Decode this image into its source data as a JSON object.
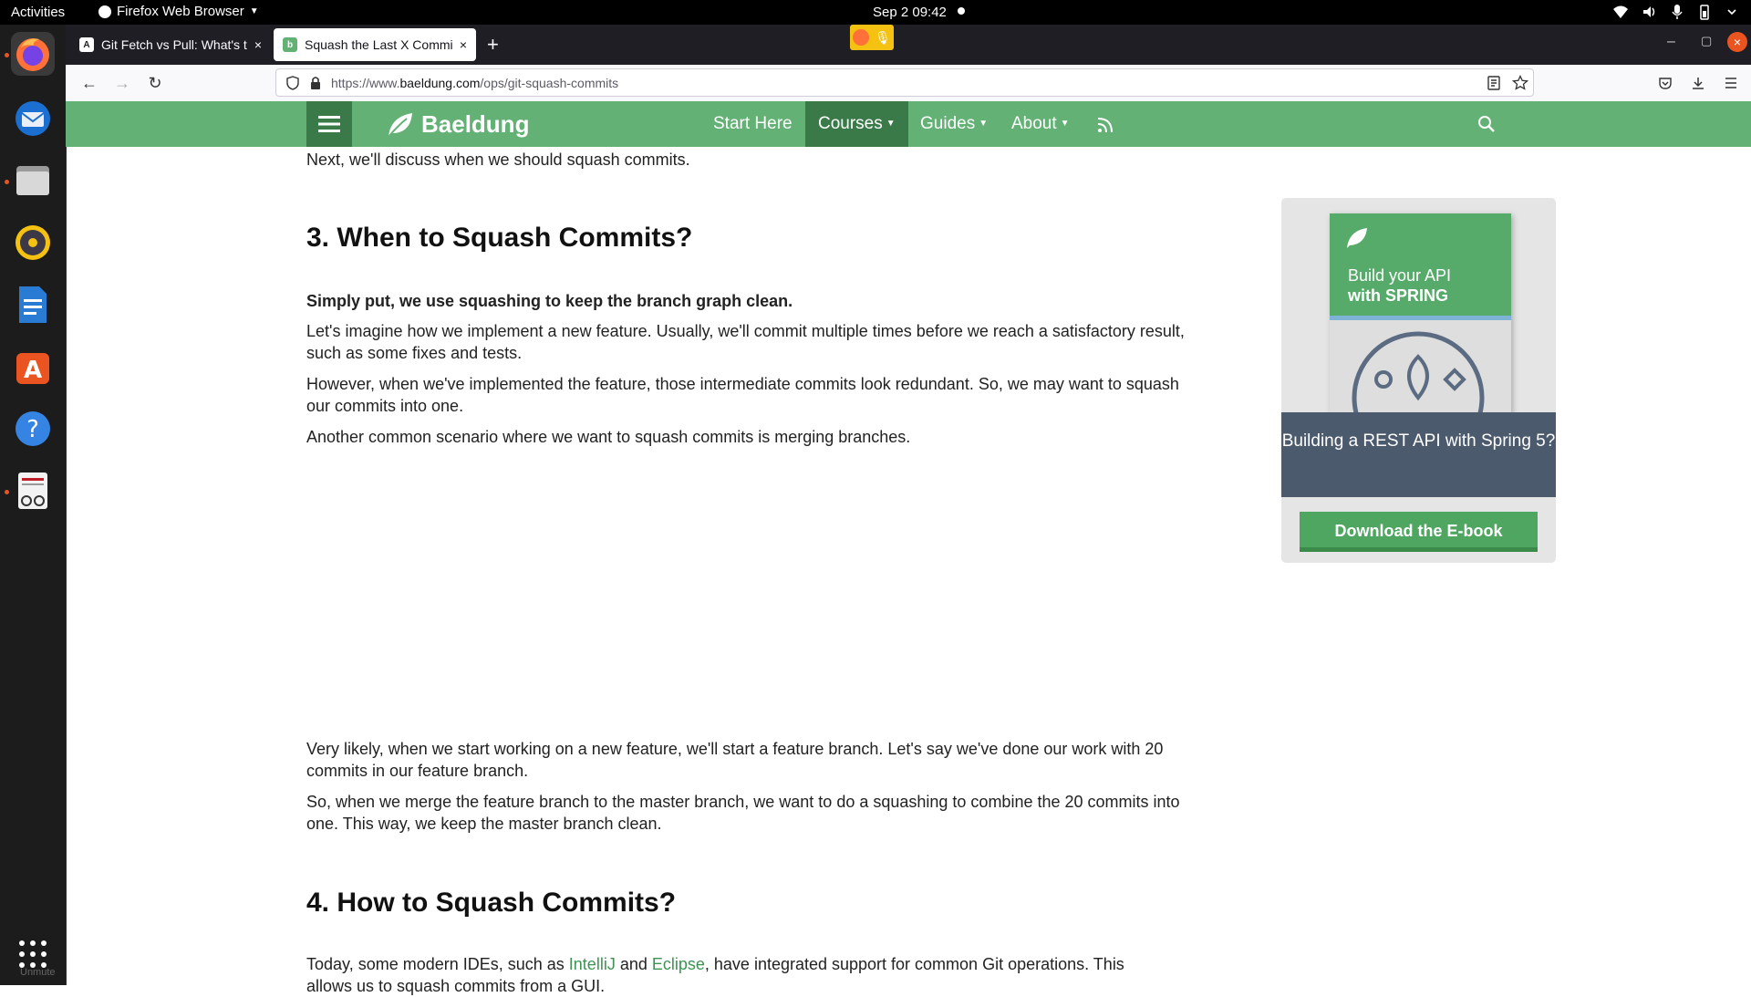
{
  "system": {
    "activities": "Activities",
    "app_menu": "Firefox Web Browser",
    "datetime": "Sep 2  09:42"
  },
  "dock": {
    "items": [
      "firefox-icon",
      "thunderbird-icon",
      "files-icon",
      "rhythmbox-icon",
      "writer-icon",
      "software-icon",
      "help-icon",
      "reader-icon"
    ],
    "show_apps_label": "Unmute"
  },
  "browser": {
    "tabs": [
      {
        "title": "Git Fetch vs Pull: What's t",
        "active": false
      },
      {
        "title": "Squash the Last X Commi",
        "active": true
      }
    ],
    "new_tab": "+",
    "url": {
      "prefix": "https://www.",
      "domain": "baeldung.com",
      "path": "/ops/git-squash-commits"
    }
  },
  "site": {
    "brand": "Baeldung",
    "menu": [
      "Start Here",
      "Courses",
      "Guides",
      "About"
    ],
    "accent": "#63b175"
  },
  "article": {
    "intro": "Next, we'll discuss when we should squash commits.",
    "section3": {
      "heading": "3. When to Squash Commits?",
      "lead": "Simply put, we use squashing to keep the branch graph clean.",
      "p1": "Let's imagine how we implement a new feature. Usually, we'll commit multiple times before we reach a satisfactory result, such as some fixes and tests.",
      "p2": "However, when we've implemented the feature, those intermediate commits look redundant. So, we may want to squash our commits into one.",
      "p3": "Another common scenario where we want to squash commits is merging branches.",
      "p4": "Very likely, when we start working on a new feature, we'll start a feature branch. Let's say we've done our work with 20 commits in our feature branch.",
      "p5": "So, when we merge the feature branch to the master branch, we want to do a squashing to combine the 20 commits into one. This way, we keep the master branch clean."
    },
    "section4": {
      "heading": "4. How to Squash Commits?",
      "p1_a": "Today, some modern IDEs, such as ",
      "link1": "IntelliJ",
      "p1_b": " and ",
      "link2": "Eclipse",
      "p1_c": ", have integrated support for common Git operations. This",
      "p1_d": "allows us to squash commits from a GUI."
    }
  },
  "ad": {
    "book_line1": "Build your API",
    "book_line2": "with SPRING",
    "caption": "Building a REST API with Spring 5?",
    "button": "Download the E-book"
  }
}
